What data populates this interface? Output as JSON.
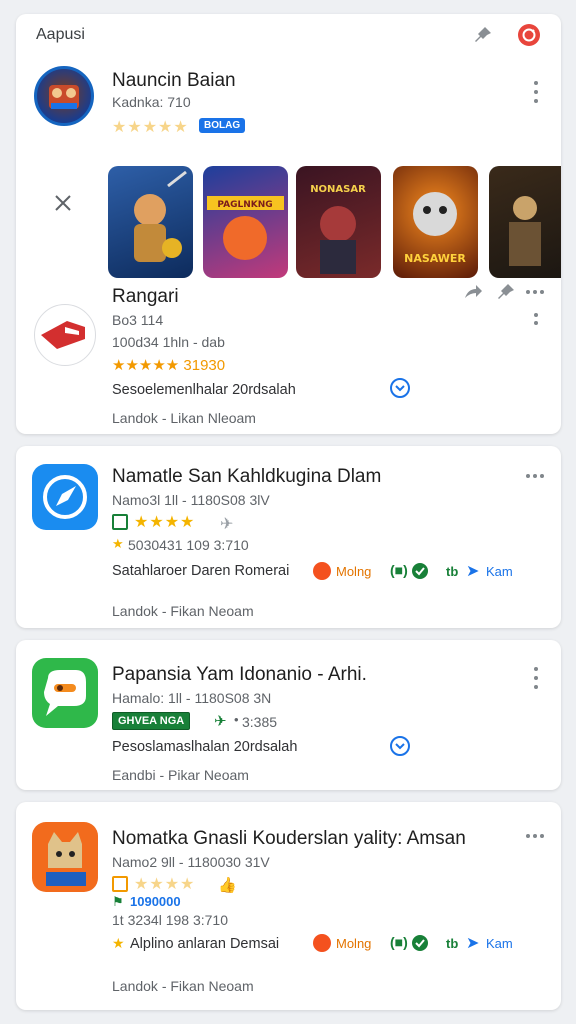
{
  "header": {
    "title": "Aapusi"
  },
  "card1": {
    "title": "Nauncin Baian",
    "meta": "Kadnka: 710",
    "badge": "BOLAG",
    "thumbs": [
      "",
      "PAGLNKNG",
      "NONASAR",
      "NASAWER",
      ""
    ],
    "app2_title": "Rangari",
    "app2_meta1": "Bo3 114",
    "app2_meta2": "100d34 1hln - dab",
    "app2_rating": "★★★★★ 31930",
    "app2_desc": "Sesoelemenlhalar 20rdsalah",
    "app2_foot": "Landok - Likan Nleoam"
  },
  "card2": {
    "title": "Namatle San Kahldkugina Dlam",
    "meta": "Namo3l 1ll - 1180S08 3lV",
    "meta2": "5030431 109 3:710",
    "desc": "Satahlaroer Daren Romerai",
    "tag1": "Molng",
    "tag3": "tb",
    "tag4": "Kam",
    "foot": "Landok - Fikan Neoam"
  },
  "card3": {
    "title": "Papansia Yam Idonanio - Arhi.",
    "meta": "Hamalo: 1ll - 1180S08 3N",
    "badge": "GHVEA NGA",
    "count": "3:385",
    "desc": "Pesoslamaslhalan 20rdsalah",
    "foot": "Eandbi - Pikar Neoam"
  },
  "card4": {
    "title": "Nomatka Gnasli Kouderslan yality: Amsan",
    "meta": "Namo2 9ll - 1180030 31V",
    "badge": "1090000",
    "meta2": "1t 3234l 198 3:710",
    "desc": "Alplino anlaran Demsai",
    "tag1": "Molng",
    "tag3": "tb",
    "tag4": "Kam",
    "foot": "Landok - Fikan Neoam"
  },
  "colors": {
    "accent": "#1a73e8",
    "star": "#f4b400",
    "green": "#188038",
    "red": "#e8453c"
  }
}
